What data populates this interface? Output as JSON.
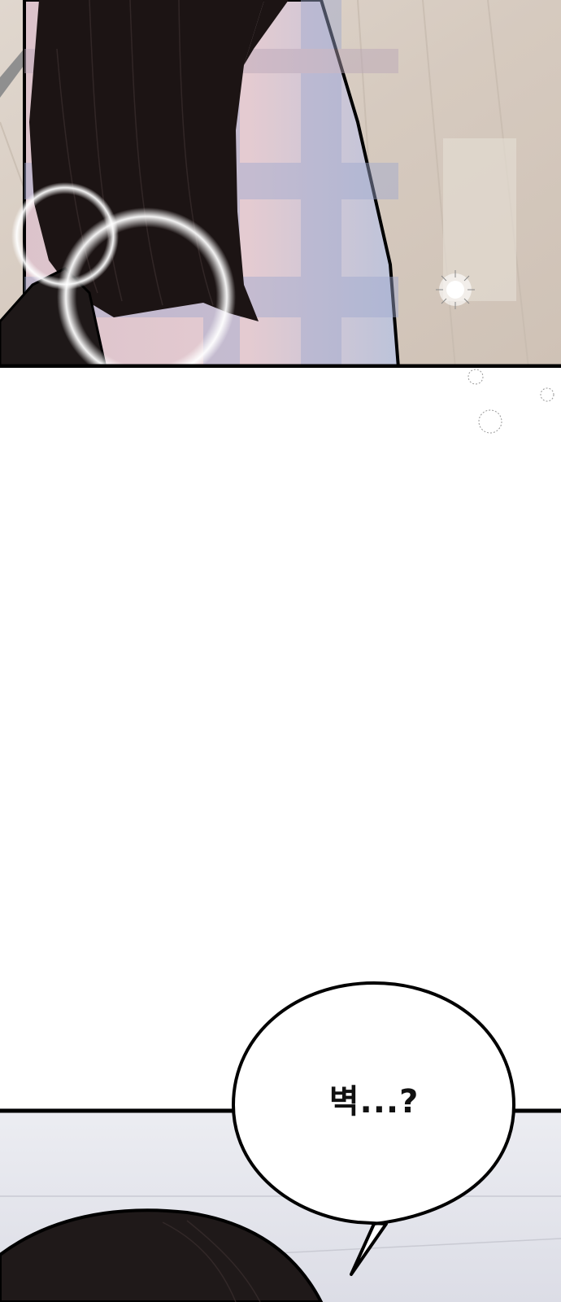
{
  "panels": [
    {
      "name": "top-panel"
    },
    {
      "name": "bottom-panel"
    }
  ],
  "speech_bubble": {
    "text": "벽...?"
  },
  "colors": {
    "ink": "#000000",
    "hair": "#1c1414",
    "floor": "#d9cfc6",
    "shirt_pink": "#e7cfd4",
    "shirt_blue": "#b7bfd6",
    "room_wall": "#e6e6ec"
  }
}
